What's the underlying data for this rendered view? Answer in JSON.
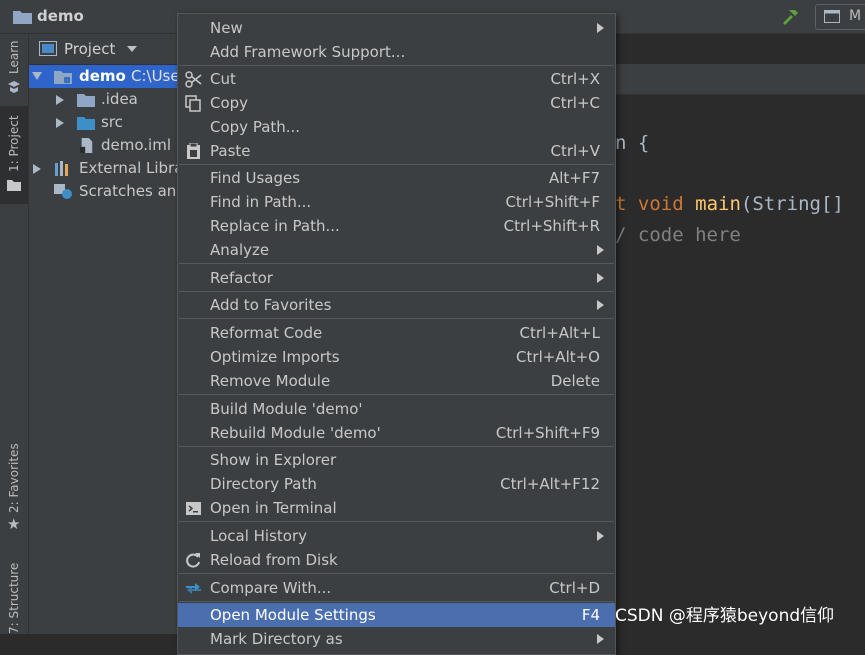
{
  "window": {
    "project_name": "demo"
  },
  "toolbar": {
    "run_config_label": "M"
  },
  "left_tabs": [
    {
      "label": "Learn"
    },
    {
      "label": "1: Project"
    },
    {
      "label": "2: Favorites"
    },
    {
      "label": "7: Structure"
    }
  ],
  "project_panel": {
    "title": "Project",
    "tree": [
      {
        "label": "demo",
        "path": "C:\\Use"
      },
      {
        "label": ".idea"
      },
      {
        "label": "src"
      },
      {
        "label": "demo.iml"
      },
      {
        "label": "External Libra"
      },
      {
        "label": "Scratches and"
      }
    ]
  },
  "editor": {
    "line1": "n {",
    "line2_kw1": "t",
    "line2_kw2": "void",
    "line2_fn": "main",
    "line2_rest": "(String[]",
    "line3": "/ code here"
  },
  "context_menu": {
    "items": [
      {
        "label": "New",
        "shortcut": "",
        "submenu": true
      },
      {
        "label": "Add Framework Support...",
        "shortcut": ""
      },
      {
        "label": "Cut",
        "shortcut": "Ctrl+X",
        "icon": "scissors-icon"
      },
      {
        "label": "Copy",
        "shortcut": "Ctrl+C",
        "icon": "copy-icon"
      },
      {
        "label": "Copy Path...",
        "shortcut": ""
      },
      {
        "label": "Paste",
        "shortcut": "Ctrl+V",
        "icon": "clipboard-icon"
      },
      {
        "label": "Find Usages",
        "shortcut": "Alt+F7"
      },
      {
        "label": "Find in Path...",
        "shortcut": "Ctrl+Shift+F"
      },
      {
        "label": "Replace in Path...",
        "shortcut": "Ctrl+Shift+R"
      },
      {
        "label": "Analyze",
        "shortcut": "",
        "submenu": true
      },
      {
        "label": "Refactor",
        "shortcut": "",
        "submenu": true
      },
      {
        "label": "Add to Favorites",
        "shortcut": "",
        "submenu": true
      },
      {
        "label": "Reformat Code",
        "shortcut": "Ctrl+Alt+L"
      },
      {
        "label": "Optimize Imports",
        "shortcut": "Ctrl+Alt+O"
      },
      {
        "label": "Remove Module",
        "shortcut": "Delete"
      },
      {
        "label": "Build Module 'demo'",
        "shortcut": ""
      },
      {
        "label": "Rebuild Module 'demo'",
        "shortcut": "Ctrl+Shift+F9"
      },
      {
        "label": "Show in Explorer",
        "shortcut": ""
      },
      {
        "label": "Directory Path",
        "shortcut": "Ctrl+Alt+F12"
      },
      {
        "label": "Open in Terminal",
        "shortcut": "",
        "icon": "terminal-icon"
      },
      {
        "label": "Local History",
        "shortcut": "",
        "submenu": true
      },
      {
        "label": "Reload from Disk",
        "shortcut": "",
        "icon": "reload-icon"
      },
      {
        "label": "Compare With...",
        "shortcut": "Ctrl+D",
        "icon": "compare-icon"
      },
      {
        "label": "Open Module Settings",
        "shortcut": "F4"
      },
      {
        "label": "Mark Directory as",
        "shortcut": "",
        "submenu": true
      }
    ]
  },
  "watermark": "CSDN @程序猿beyond信仰",
  "colors": {
    "selection": "#2f65ca",
    "menu_highlight": "#4b6eaf",
    "keyword": "#cc7832",
    "function": "#ffc66d",
    "comment": "#808080"
  }
}
